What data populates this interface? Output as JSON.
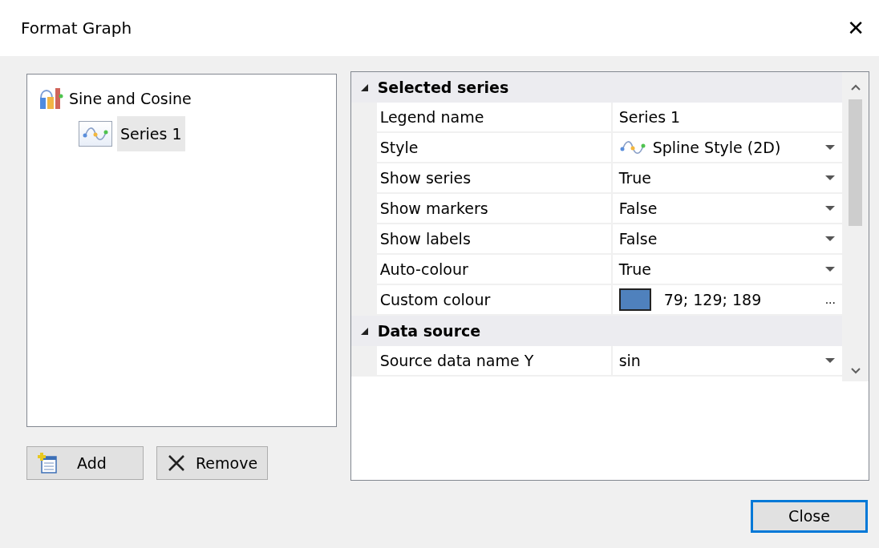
{
  "window": {
    "title": "Format Graph",
    "close_glyph": "✕"
  },
  "tree": [
    {
      "label": "Sine and Cosine",
      "selected": false,
      "children": [
        {
          "label": "Series 1",
          "selected": true
        }
      ]
    }
  ],
  "buttons": [
    {
      "label": "Add",
      "kind": "add"
    },
    {
      "label": "Remove",
      "kind": "remove"
    }
  ],
  "categories": [
    {
      "label": "Selected series",
      "expanded": true,
      "rows": [
        {
          "label": "Legend name",
          "value": "Series 1",
          "kind": "text"
        },
        {
          "label": "Style",
          "value": "Spline Style (2D)",
          "kind": "dropdown",
          "has_icon": true
        },
        {
          "label": "Show series",
          "value": "True",
          "kind": "dropdown"
        },
        {
          "label": "Show markers",
          "value": "False",
          "kind": "dropdown"
        },
        {
          "label": "Show labels",
          "value": "False",
          "kind": "dropdown"
        },
        {
          "label": "Auto-colour",
          "value": "True",
          "kind": "dropdown"
        },
        {
          "label": "Custom colour",
          "value": "79; 129; 189",
          "kind": "color",
          "color": "#4f81bd",
          "ellipsis": "..."
        }
      ]
    },
    {
      "label": "Data source",
      "expanded": true,
      "rows": [
        {
          "label": "Source data name Y",
          "value": "sin",
          "kind": "dropdown"
        }
      ]
    }
  ],
  "close_button": {
    "label": "Close",
    "default": true
  }
}
